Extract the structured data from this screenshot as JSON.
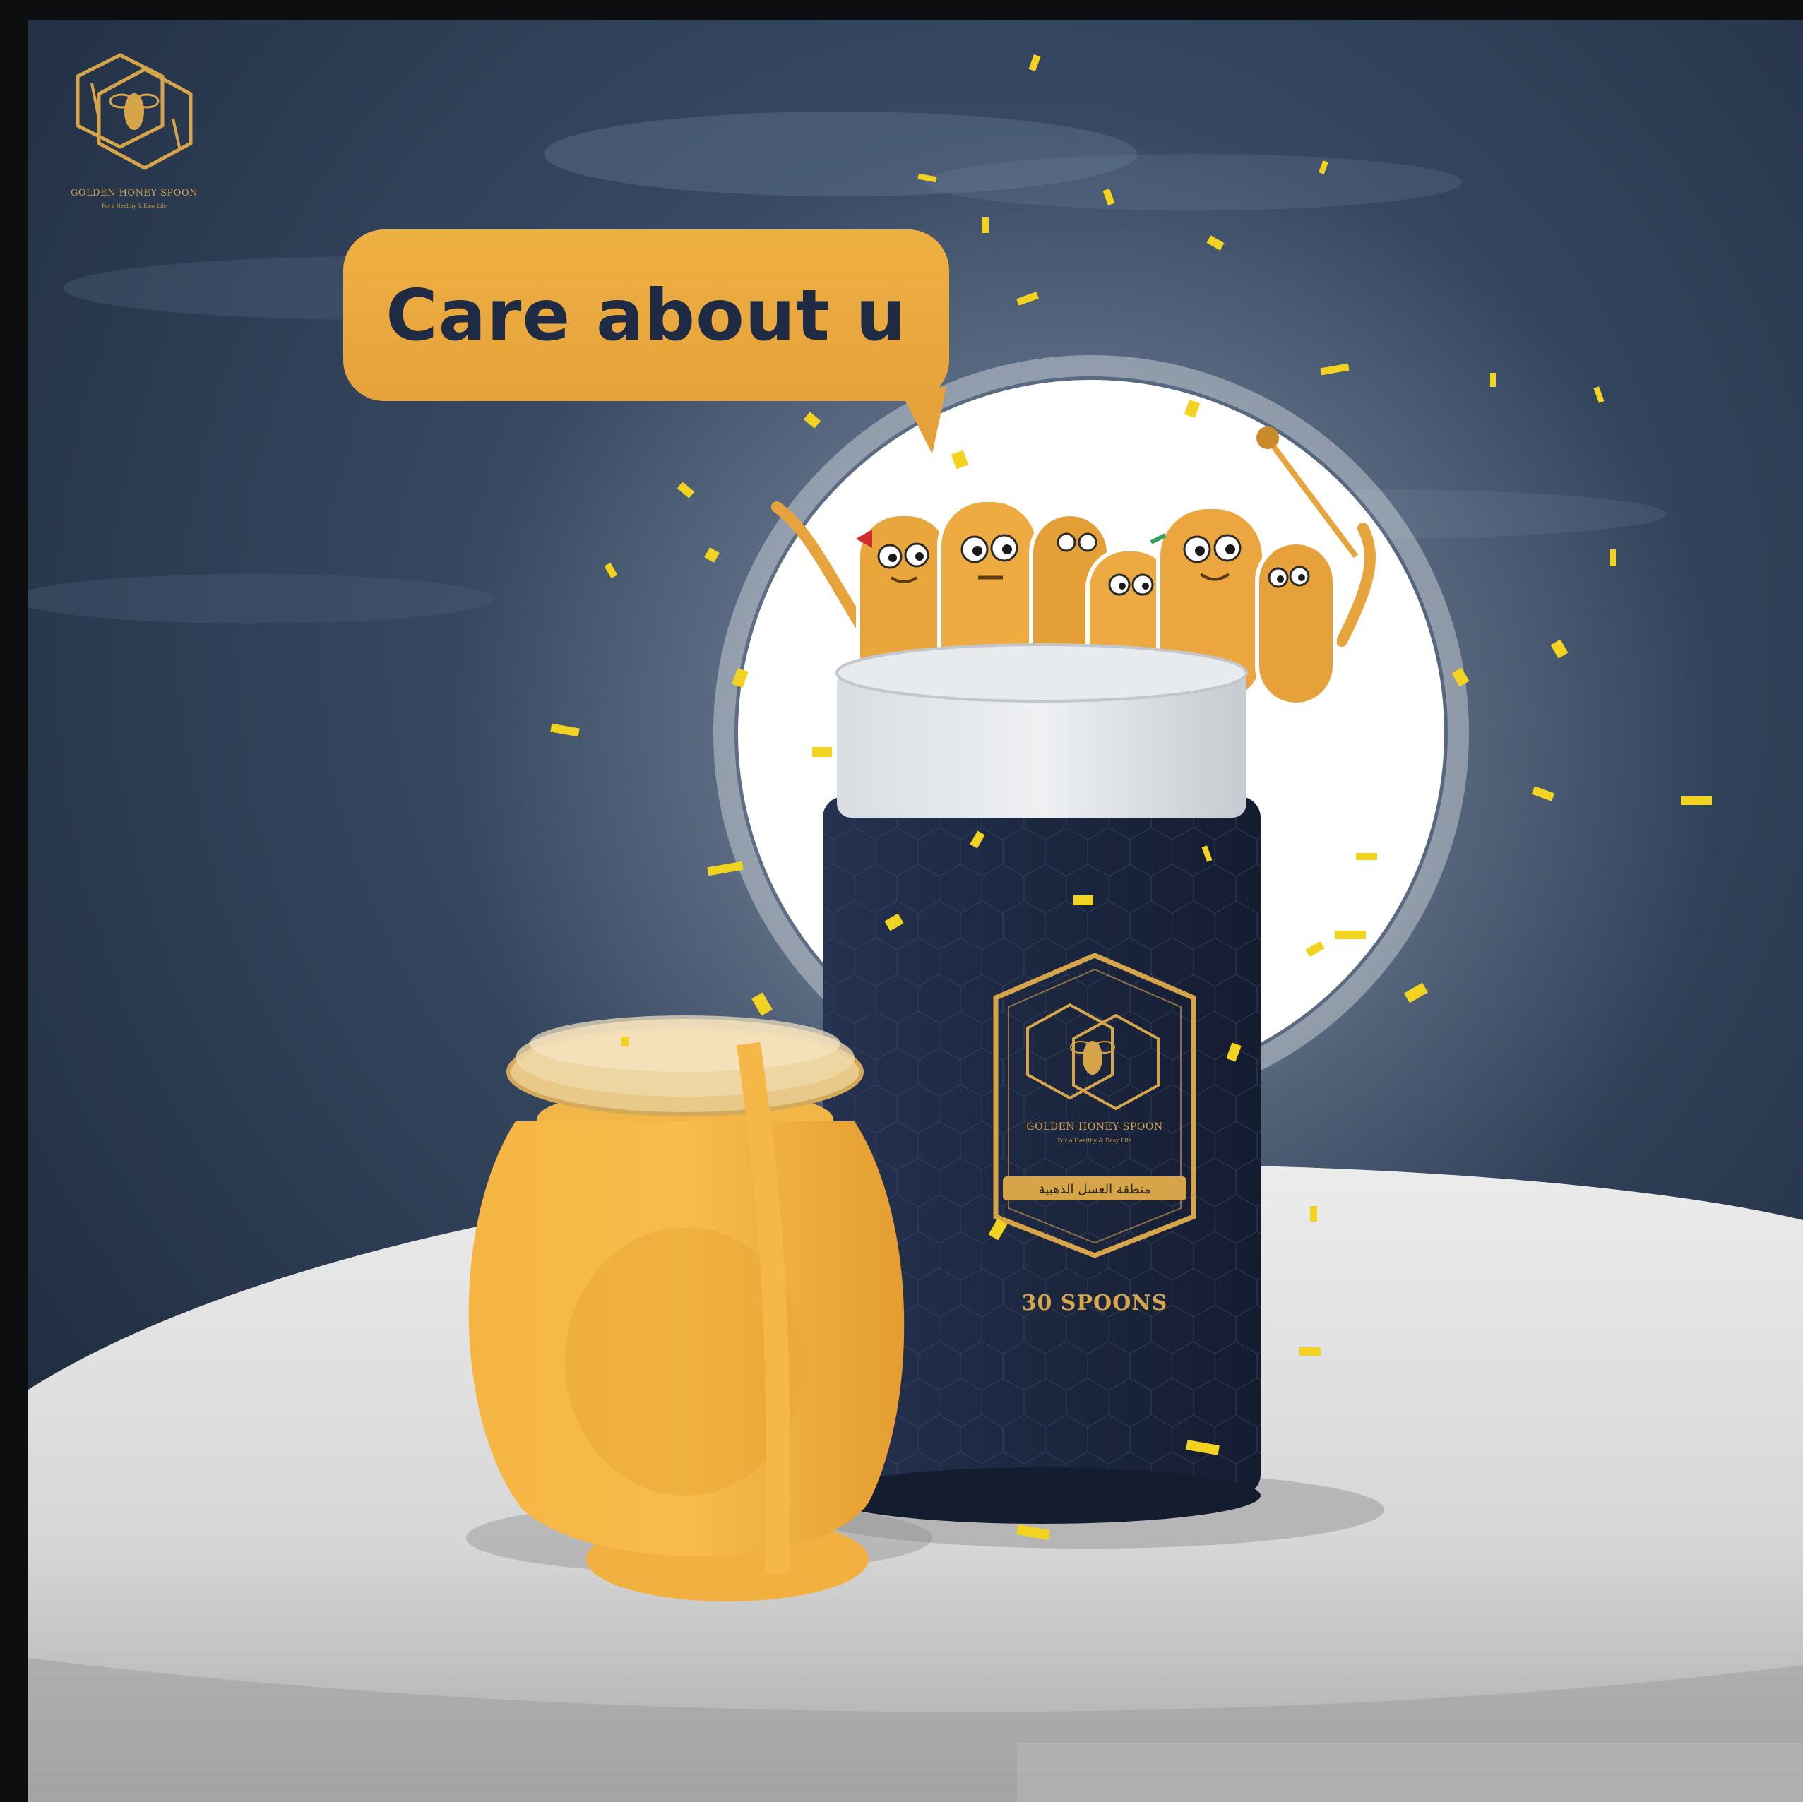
{
  "brand": {
    "name": "GOLDEN HONEY SPOON",
    "tagline": "For a Healthy & Easy Life"
  },
  "speech_bubble": {
    "text": "Care about u"
  },
  "product": {
    "label_brand": "GOLDEN HONEY SPOON",
    "label_tagline": "For a Healthy & Easy Life",
    "label_arabic": "منطقة العسل الذهبية",
    "count_label": "30 SPOONS"
  },
  "colors": {
    "background": "#2b3a52",
    "honey": "#f3b040",
    "canister": "#1d2740",
    "gold_accent": "#d6a54a",
    "moon": "#ffffff"
  },
  "icons": [
    "honeycomb-bee-logo",
    "bee-icon",
    "confetti",
    "spoon-characters"
  ]
}
